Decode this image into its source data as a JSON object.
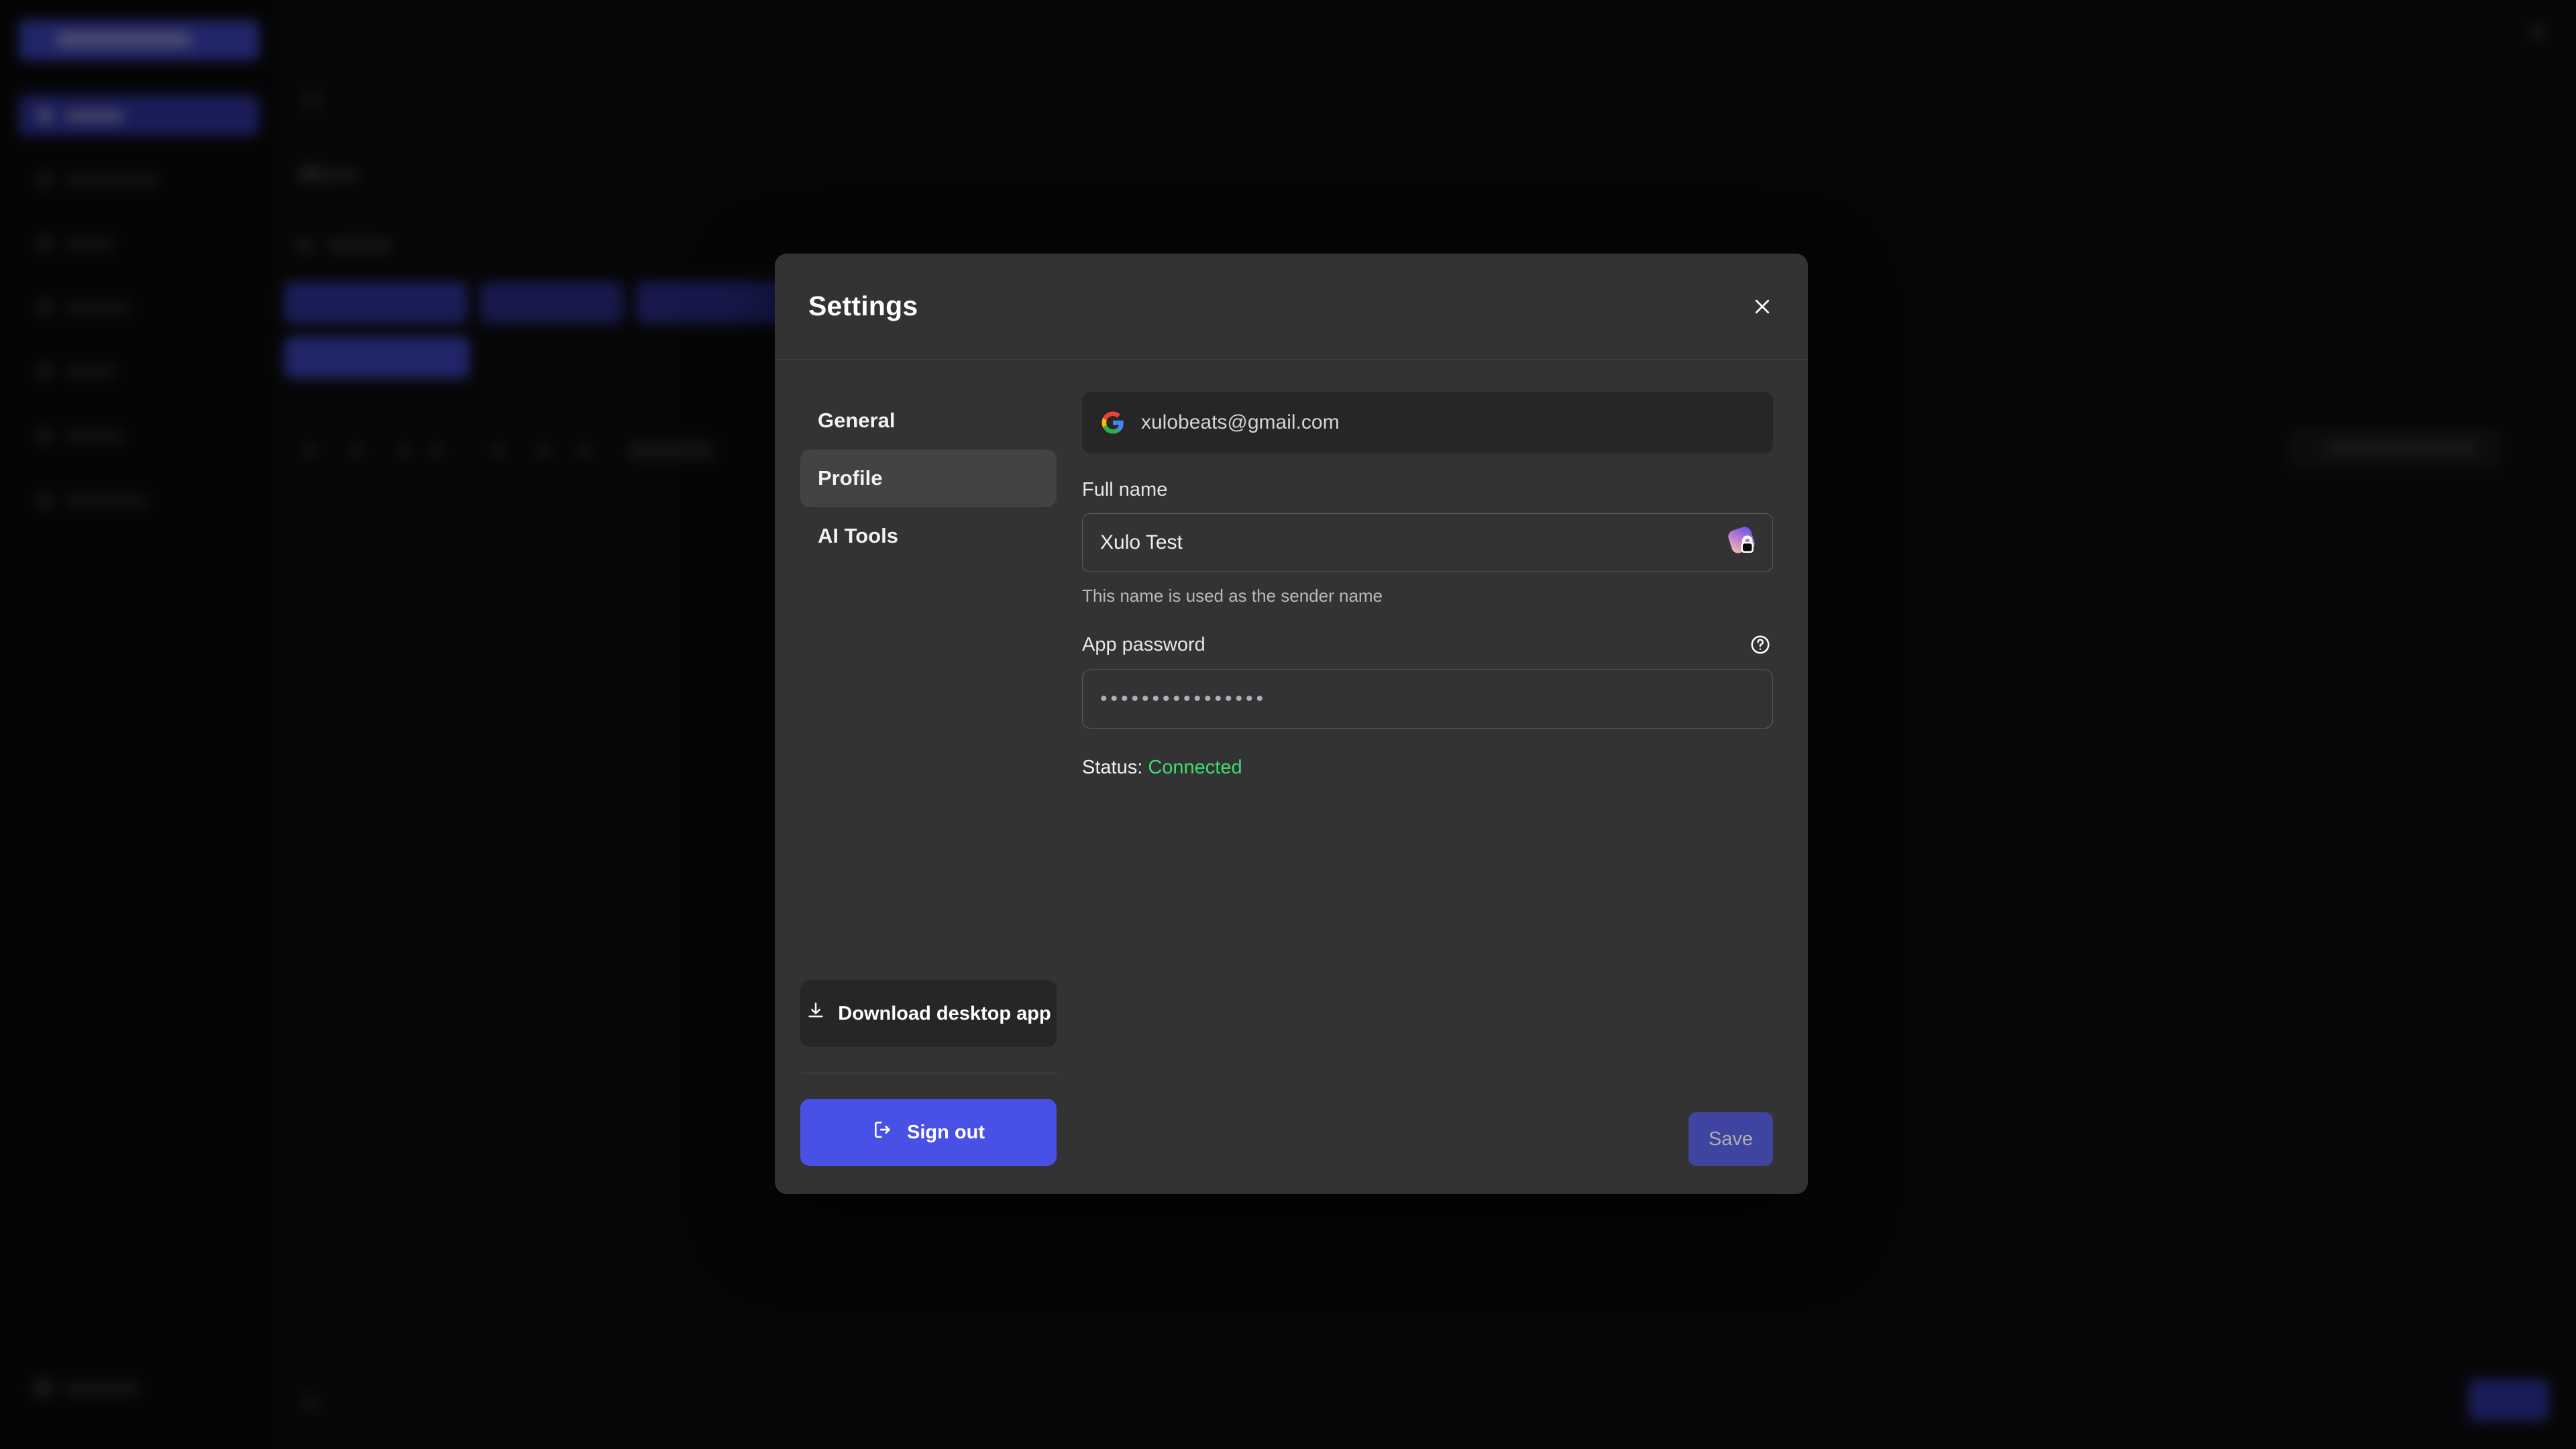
{
  "background": {
    "compose_button": "",
    "nav_items": [
      "",
      "",
      "",
      "",
      "",
      ""
    ],
    "note": ""
  },
  "modal": {
    "title": "Settings",
    "close_icon": "close-icon",
    "nav": {
      "items": [
        {
          "label": "General",
          "active": false
        },
        {
          "label": "Profile",
          "active": true
        },
        {
          "label": "AI Tools",
          "active": false
        }
      ],
      "download_button": {
        "label": "Download desktop app",
        "icon": "download-icon"
      },
      "signout_button": {
        "label": "Sign out",
        "icon": "log-out-icon"
      }
    },
    "content": {
      "account": {
        "icon": "google-logo-icon",
        "email": "xulobeats@gmail.com"
      },
      "full_name": {
        "label": "Full name",
        "value": "Xulo Test",
        "placeholder": "Full name",
        "hint": "This name is used as the sender name",
        "autofill_icon": "password-manager-lock-icon"
      },
      "app_password": {
        "label": "App password",
        "help_icon": "help-circle-icon",
        "value": "••••••••••••••••",
        "placeholder": "App password"
      },
      "status": {
        "label": "Status:",
        "value": "Connected"
      },
      "save_button": {
        "label": "Save",
        "disabled": true
      }
    }
  },
  "colors": {
    "modal_bg": "#333333",
    "modal_nav_active": "#434343",
    "accent_blue": "#4850e6",
    "save_disabled": "#3f44a0",
    "status_connected": "#3ddc72",
    "input_bg": "#262626",
    "app_bg": "#0d0d0f"
  }
}
